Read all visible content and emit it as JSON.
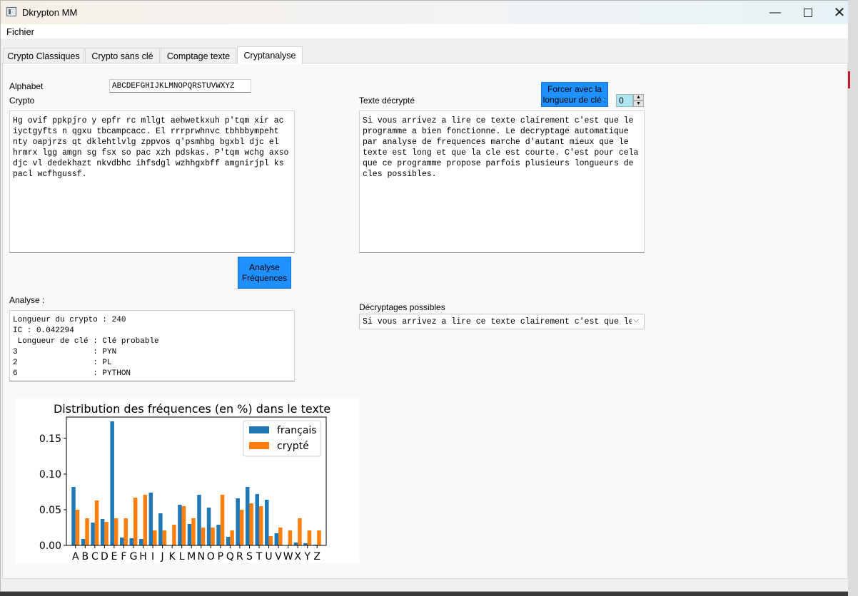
{
  "window": {
    "title": "Dkrypton MM"
  },
  "menu": {
    "file": "Fichier"
  },
  "tabs": [
    "Crypto Classiques",
    "Crypto sans clé",
    "Comptage texte",
    "Cryptanalyse"
  ],
  "alphabet": {
    "label": "Alphabet",
    "value": "ABCDEFGHIJKLMNOPQRSTUVWXYZ"
  },
  "crypto": {
    "label": "Crypto",
    "text": "Hg ovif ppkpjro y epfr rc mllgt aehwetkxuh p'tqm xir ac iyctgyfts n qgxu tbcampcacc. El rrrprwhnvc tbhbbympeht nty oapjrzs qt dklehtlvlg zppvos q'psmhbg bgxbl djc el hrmrx lgg amgn sg fsx so pac xzh pdskas. P'tqm wchg axso djc vl dedekhazt nkvdbhc ihfsdgl wzhhgxbff amgnirjpl ks pacl wcfhgussf."
  },
  "decrypted": {
    "label": "Texte décrypté",
    "text": "Si vous arrivez a lire ce texte clairement c'est que le programme a bien fonctionne. Le decryptage automatique par analyse de frequences marche d'autant mieux que le texte est long et que la cle est courte. C'est pour cela que ce programme propose parfois plusieurs longueurs de cles possibles."
  },
  "force_button": {
    "line1": "Forcer avec la",
    "line2": "longueur de clé :"
  },
  "key_length": {
    "value": "0"
  },
  "analyse_button": {
    "line1": "Analyse",
    "line2": "Fréquences"
  },
  "analyse": {
    "label": "Analyse :",
    "text": "Longueur du crypto : 240\nIC : 0.042294\n Longueur de clé : Clé probable\n3                : PYN\n2                : PL\n6                : PYTHON"
  },
  "possible": {
    "label": "Décryptages possibles",
    "selected": "Si vous arrivez a lire ce texte clairement c'est que le"
  },
  "colors": {
    "francais": "#1f77b4",
    "crypte": "#ff7f0e",
    "button": "#1e90ff"
  },
  "chart_data": {
    "type": "bar",
    "title": "Distribution des fréquences (en %) dans le texte",
    "categories": [
      "A",
      "B",
      "C",
      "D",
      "E",
      "F",
      "G",
      "H",
      "I",
      "J",
      "K",
      "L",
      "M",
      "N",
      "O",
      "P",
      "Q",
      "R",
      "S",
      "T",
      "U",
      "V",
      "W",
      "X",
      "Y",
      "Z"
    ],
    "series": [
      {
        "name": "français",
        "values": [
          0.082,
          0.009,
          0.032,
          0.037,
          0.174,
          0.011,
          0.01,
          0.009,
          0.074,
          0.045,
          0.0,
          0.057,
          0.03,
          0.071,
          0.053,
          0.029,
          0.012,
          0.066,
          0.082,
          0.072,
          0.064,
          0.017,
          0.0,
          0.004,
          0.003,
          0.001
        ]
      },
      {
        "name": "crypté",
        "values": [
          0.05,
          0.038,
          0.063,
          0.033,
          0.038,
          0.038,
          0.067,
          0.071,
          0.021,
          0.021,
          0.029,
          0.055,
          0.038,
          0.025,
          0.025,
          0.071,
          0.021,
          0.05,
          0.059,
          0.055,
          0.013,
          0.025,
          0.021,
          0.038,
          0.021,
          0.021
        ]
      }
    ],
    "yticks": [
      "0.00",
      "0.05",
      "0.10",
      "0.15"
    ],
    "ylim": [
      0,
      0.18
    ],
    "legend": "top-right"
  }
}
